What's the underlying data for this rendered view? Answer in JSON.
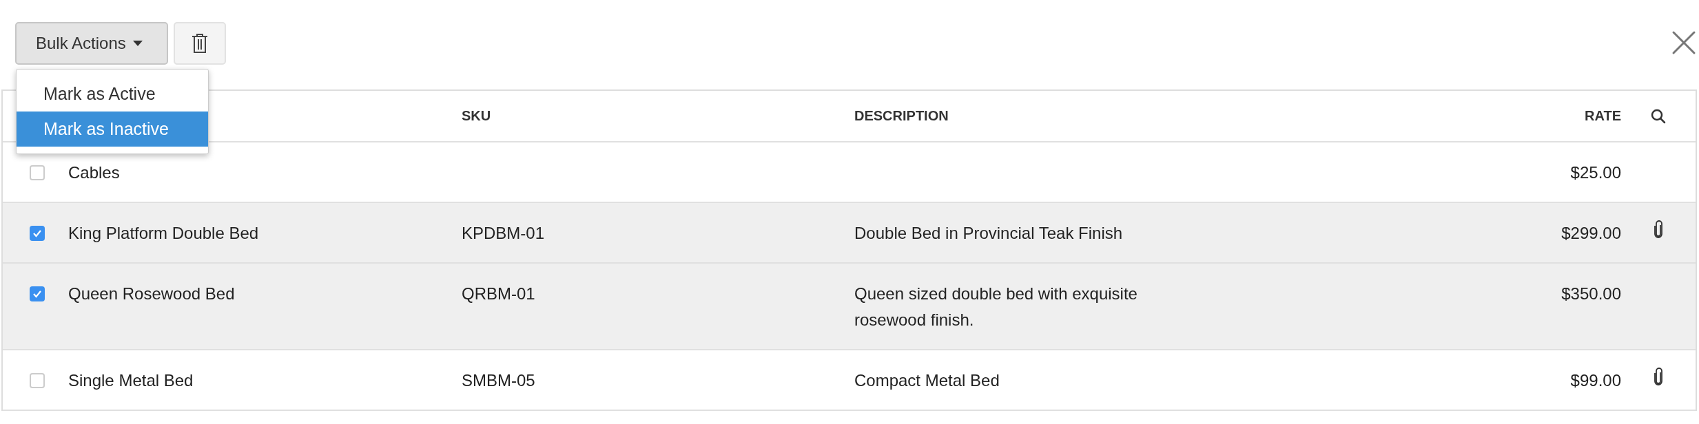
{
  "toolbar": {
    "bulk_actions": {
      "label": "Bulk Actions",
      "expanded": true
    }
  },
  "menu": {
    "items": [
      {
        "label": "Mark as Active",
        "selected": false
      },
      {
        "label": "Mark as Inactive",
        "selected": true
      }
    ]
  },
  "table": {
    "columns": [
      "",
      "SKU",
      "DESCRIPTION",
      "RATE"
    ],
    "rows": [
      {
        "checked": false,
        "name": "Cables",
        "rate": "$25.00",
        "attachment": false
      },
      {
        "checked": true,
        "name": "King Platform Double Bed",
        "sku": "KPDBM-01",
        "description": "Double Bed in Provincial Teak Finish",
        "rate": "$299.00",
        "attachment": true
      },
      {
        "checked": true,
        "name": "Queen Rosewood Bed",
        "sku": "QRBM-01",
        "description": "Queen sized double bed with exquisite rosewood finish.",
        "rate": "$350.00",
        "attachment": false
      },
      {
        "checked": false,
        "name": "Single Metal Bed",
        "sku": "SMBM-05",
        "description": "Compact Metal Bed",
        "rate": "$99.00",
        "attachment": true
      }
    ]
  }
}
